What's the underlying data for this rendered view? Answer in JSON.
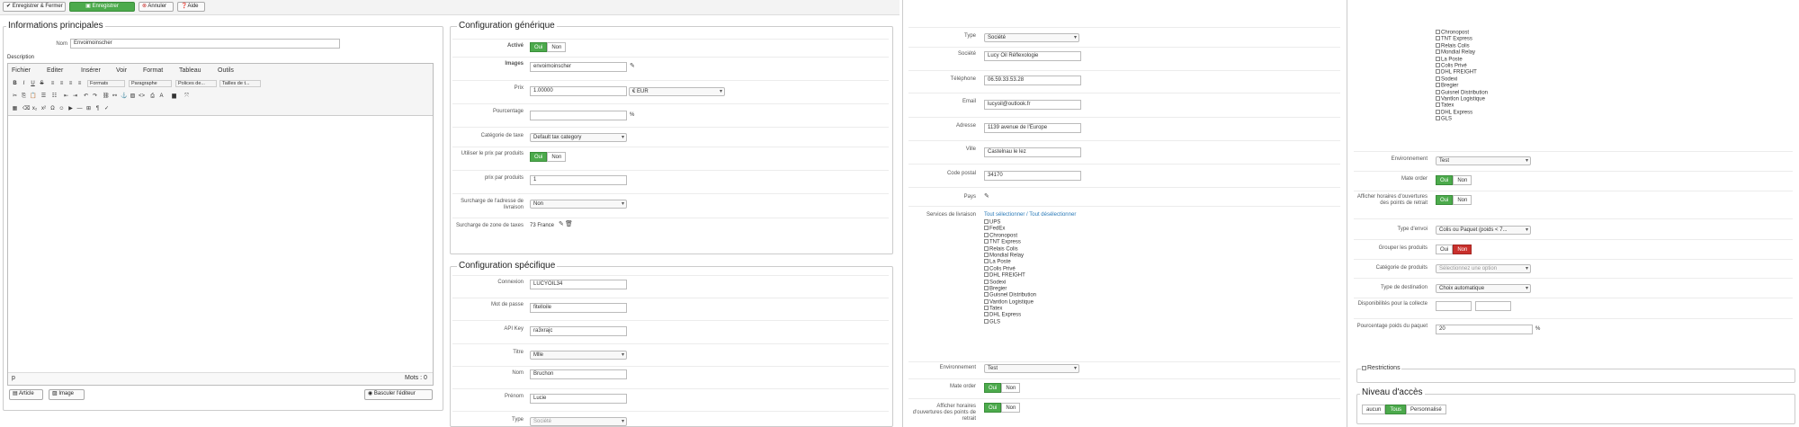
{
  "toolbar": {
    "save_close": "Enregistrer & Fermer",
    "save": "Enregistrer",
    "cancel": "Annuler",
    "help": "Aide"
  },
  "main": {
    "legend": "Informations principales",
    "name_label": "Nom",
    "name_value": "Envoimoinscher",
    "desc_label": "Description",
    "menus": [
      "Fichier",
      "Editer",
      "Insérer",
      "Voir",
      "Format",
      "Tableau",
      "Outils"
    ],
    "selects": [
      "Formats",
      "Paragraphe",
      "Polices de...",
      "Tailles de t..."
    ],
    "status_path": "p",
    "word_count": "Mots : 0",
    "btn_article": "Article",
    "btn_image": "Image",
    "btn_toggle": "Basculer l'éditeur"
  },
  "generic": {
    "legend": "Configuration générique",
    "active_label": "Activé",
    "yes": "Oui",
    "no": "Non",
    "images_label": "Images",
    "images_value": "envoimoinscher",
    "price_label": "Prix",
    "price_value": "1.00000",
    "currency": "€ EUR",
    "percent_label": "Pourcentage",
    "percent_sign": "%",
    "tax_label": "Catégorie de taxe",
    "tax_value": "Default tax category",
    "use_product_price_label": "Utiliser le prix par produits",
    "price_per_product_label": "prix par produits",
    "price_per_product_value": "1",
    "delivery_override_label": "Surcharge de l'adresse de livraison",
    "delivery_override_value": "Non",
    "tax_zone_override_label": "Surcharge de zone de taxes",
    "tax_zone_value": "73 France"
  },
  "specific": {
    "legend": "Configuration spécifique",
    "login_label": "Connexion",
    "login_value": "LUCYOIL34",
    "password_label": "Mot de passe",
    "password_value": "fitelloile",
    "apikey_label": "API Key",
    "apikey_value": "ra3xrajc",
    "title_label": "Titre",
    "title_value": "Mlle",
    "lastname_label": "Nom",
    "lastname_value": "Bruchon",
    "firstname_label": "Prénom",
    "firstname_value": "Lucie",
    "type_label": "Type",
    "type_value": "Société"
  },
  "right": {
    "type_label": "Type",
    "type_value": "Société",
    "company_label": "Société",
    "company_value": "Lucy Oil Réflexologie",
    "phone_label": "Téléphone",
    "phone_value": "06.59.33.53.28",
    "email_label": "Email",
    "email_value": "lucyoil@outlook.fr",
    "address_label": "Adresse",
    "address_value": "1139 avenue de l'Europe",
    "city_label": "Ville",
    "city_value": "Castelnau le lez",
    "zip_label": "Code postal",
    "zip_value": "34170",
    "country_label": "Pays",
    "services_label": "Services de livraison",
    "select_all": "Tout sélectionner",
    "separator": " / ",
    "deselect_all": "Tout désélectionner",
    "services": [
      "UPS",
      "FedEx",
      "Chronopost",
      "TNT Express",
      "Relais Colis",
      "Mondial Relay",
      "La Poste",
      "Colis Privé",
      "DHL FREIGHT",
      "Sodexi",
      "Bregier",
      "Guisnel Distribution",
      "Vantlon Logistique",
      "Tatex",
      "DHL Express",
      "GLS"
    ],
    "env_label": "Environnement",
    "env_value": "Test",
    "mate_label": "Mate order",
    "yes": "Oui",
    "no": "Non",
    "hours_label": "Afficher horaires d'ouvertures des points de retrait"
  },
  "far": {
    "services_top": [
      "Chronopost",
      "TNT Express",
      "Relais Colis",
      "Mondial Relay",
      "La Poste",
      "Colis Privé",
      "DHL FREIGHT",
      "Sodexi",
      "Bregier",
      "Guisnel Distribution",
      "Vantlon Logistique",
      "Tatex",
      "DHL Express",
      "GLS"
    ],
    "env_label": "Environnement",
    "env_value": "Test",
    "mate_label": "Mate order",
    "hours_label": "Afficher horaires d'ouvertures des points de retrait",
    "send_type_label": "Type d'envoi",
    "send_type_value": "Colis ou Paquet (poids < 7...",
    "group_label": "Grouper les produits",
    "product_cat_label": "Catégorie de produits",
    "product_cat_value": "Sélectionnez une option",
    "dest_type_label": "Type de destination",
    "dest_type_value": "Choix automatique",
    "pickup_label": "Disponibilités pour la collecte",
    "weight_pct_label": "Pourcentage poids du paquet",
    "weight_pct_value": "20",
    "pct": "%",
    "yes": "Oui",
    "no": "Non",
    "restrictions": "Restrictions",
    "access_legend": "Niveau d'accès",
    "access_opts": [
      "aucun",
      "Tous",
      "Personnalisé"
    ]
  },
  "colors": {
    "green": "#4caa4c",
    "red": "#c9302c",
    "link": "#2a7ab8"
  }
}
